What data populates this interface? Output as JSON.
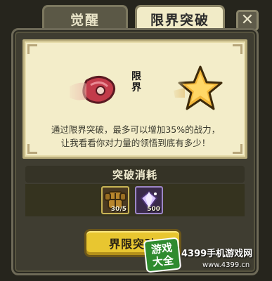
{
  "tabs": {
    "awaken_label": "觉醒",
    "limit_break_label": "限界突破",
    "close_label": "✕"
  },
  "card": {
    "limit_label": "限界",
    "before_item_icon": "meat-icon",
    "after_item_icon": "star-icon",
    "description_line1": "通过限界突破，最多可以增加35%的战力，",
    "description_line2": "让我看看你对力量的领悟到底有多少！"
  },
  "cost": {
    "title": "突破消耗",
    "items": [
      {
        "icon": "armor-icon",
        "count": "30/5"
      },
      {
        "icon": "gem-icon",
        "count": "500"
      }
    ]
  },
  "button": {
    "label": "界限突破"
  },
  "watermark": {
    "badge_line1": "游戏",
    "badge_line2": "大全",
    "site_name": "4399手机游戏网",
    "url": "www.4399.cn"
  },
  "colors": {
    "accent_button": "#e8c630",
    "parchment": "#f3edc9",
    "panel": "#3f3d31"
  }
}
